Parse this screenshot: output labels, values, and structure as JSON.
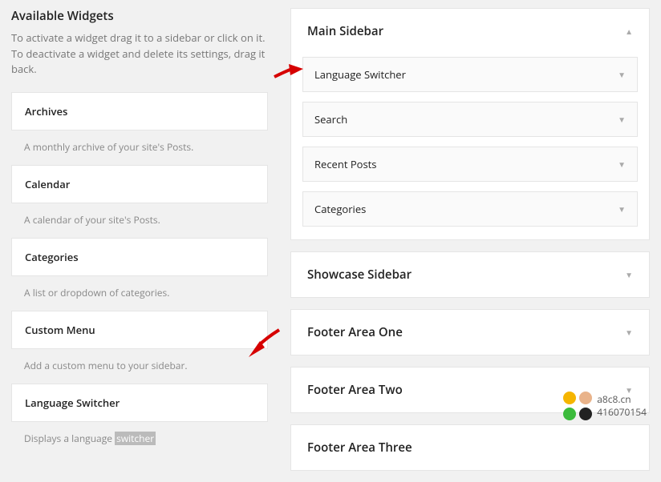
{
  "left": {
    "title": "Available Widgets",
    "desc": "To activate a widget drag it to a sidebar or click on it. To deactivate a widget and delete its settings, drag it back.",
    "widgets": [
      {
        "name": "Archives",
        "desc": "A monthly archive of your site's Posts."
      },
      {
        "name": "Calendar",
        "desc": "A calendar of your site's Posts."
      },
      {
        "name": "Categories",
        "desc": "A list or dropdown of categories."
      },
      {
        "name": "Custom Menu",
        "desc": "Add a custom menu to your sidebar."
      },
      {
        "name": "Language Switcher",
        "desc_prefix": "Displays a language ",
        "desc_highlight": "switcher"
      }
    ]
  },
  "right": {
    "main_sidebar": {
      "title": "Main Sidebar",
      "expanded": true,
      "widgets": [
        {
          "label": "Language Switcher"
        },
        {
          "label": "Search"
        },
        {
          "label": "Recent Posts"
        },
        {
          "label": "Categories"
        }
      ]
    },
    "collapsed": [
      {
        "title": "Showcase Sidebar"
      },
      {
        "title": "Footer Area One"
      },
      {
        "title": "Footer Area Two"
      },
      {
        "title": "Footer Area Three"
      }
    ]
  },
  "footer_badge": {
    "line1": "a8c8.cn",
    "line2": "416070154"
  }
}
